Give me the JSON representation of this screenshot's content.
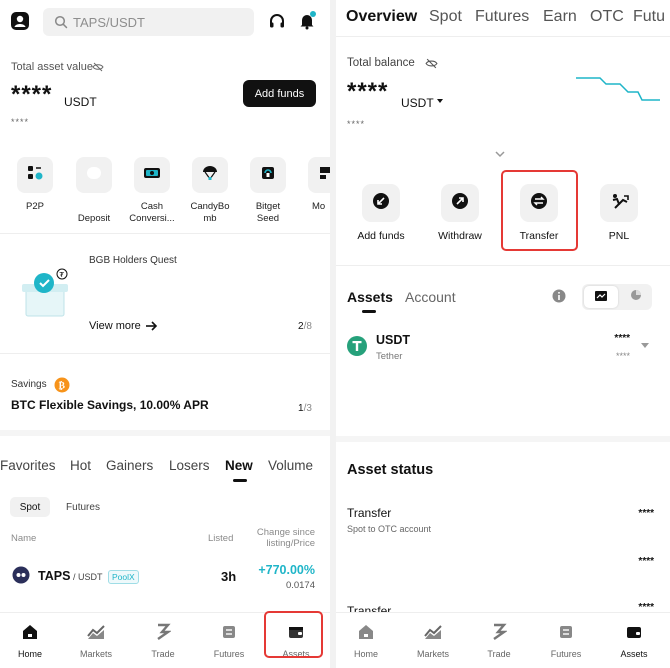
{
  "left": {
    "search_placeholder": "TAPS/USDT",
    "total_asset_label": "Total asset value",
    "total_asset_masked": "****",
    "total_asset_unit": "USDT",
    "total_asset_sub_masked": "****",
    "add_funds": "Add funds",
    "shortcuts": [
      {
        "label": "P2P",
        "icon": "p2p-icon"
      },
      {
        "label": "Deposit",
        "icon": "deposit-icon"
      },
      {
        "label": "Cash\nConversi...",
        "icon": "cash-conversion-icon"
      },
      {
        "label": "CandyBo\nmb",
        "icon": "candybomb-icon"
      },
      {
        "label": "Bitget\nSeed",
        "icon": "seed-icon"
      },
      {
        "label": "Mo",
        "icon": "more-icon"
      }
    ],
    "promo": {
      "title": "BGB Holders Quest",
      "view_more": "View more",
      "page": "2",
      "page_total": "/8"
    },
    "savings": {
      "label": "Savings",
      "title": "BTC Flexible Savings, 10.00% APR",
      "page": "1",
      "page_total": "/3"
    },
    "market_tabs": [
      "Favorites",
      "Hot",
      "Gainers",
      "Losers",
      "New",
      "Volume"
    ],
    "market_active_tab": "New",
    "sub_tabs": [
      "Spot",
      "Futures"
    ],
    "columns": {
      "name": "Name",
      "listed": "Listed",
      "change1": "Change since",
      "change2": "listing/Price"
    },
    "rows": [
      {
        "base": "TAPS",
        "quote": " / USDT",
        "badge": "PoolX",
        "listed": "3h",
        "change": "+770.00%",
        "price": "0.0174"
      }
    ],
    "nav": [
      "Home",
      "Markets",
      "Trade",
      "Futures",
      "Assets"
    ]
  },
  "right": {
    "tabs": [
      "Overview",
      "Spot",
      "Futures",
      "Earn",
      "OTC",
      "Futu"
    ],
    "active_tab": "Overview",
    "total_balance_label": "Total balance",
    "balance_masked": "****",
    "balance_unit": "USDT",
    "balance_sub_masked": "****",
    "actions": [
      {
        "label": "Add funds",
        "icon": "add-funds-icon"
      },
      {
        "label": "Withdraw",
        "icon": "withdraw-icon"
      },
      {
        "label": "Transfer",
        "icon": "transfer-icon"
      },
      {
        "label": "PNL",
        "icon": "pnl-icon"
      }
    ],
    "asset_tabs": [
      "Assets",
      "Account"
    ],
    "asset_row": {
      "symbol": "USDT",
      "name": "Tether",
      "amount_masked": "****",
      "value_masked": "****"
    },
    "asset_status_title": "Asset status",
    "status_items": [
      {
        "title": "Transfer",
        "subtitle": "Spot to OTC account",
        "value": "****"
      },
      {
        "title": "",
        "subtitle": "",
        "value": "****"
      },
      {
        "title": "Transfer",
        "subtitle": "",
        "value": "****"
      }
    ],
    "nav": [
      "Home",
      "Markets",
      "Trade",
      "Futures",
      "Assets"
    ]
  },
  "colors": {
    "accent_teal": "#1fb5c8",
    "positive": "#1fb5c8",
    "highlight_red": "#e53935",
    "usdt_green": "#26a17b",
    "btc_orange": "#f7931a"
  }
}
